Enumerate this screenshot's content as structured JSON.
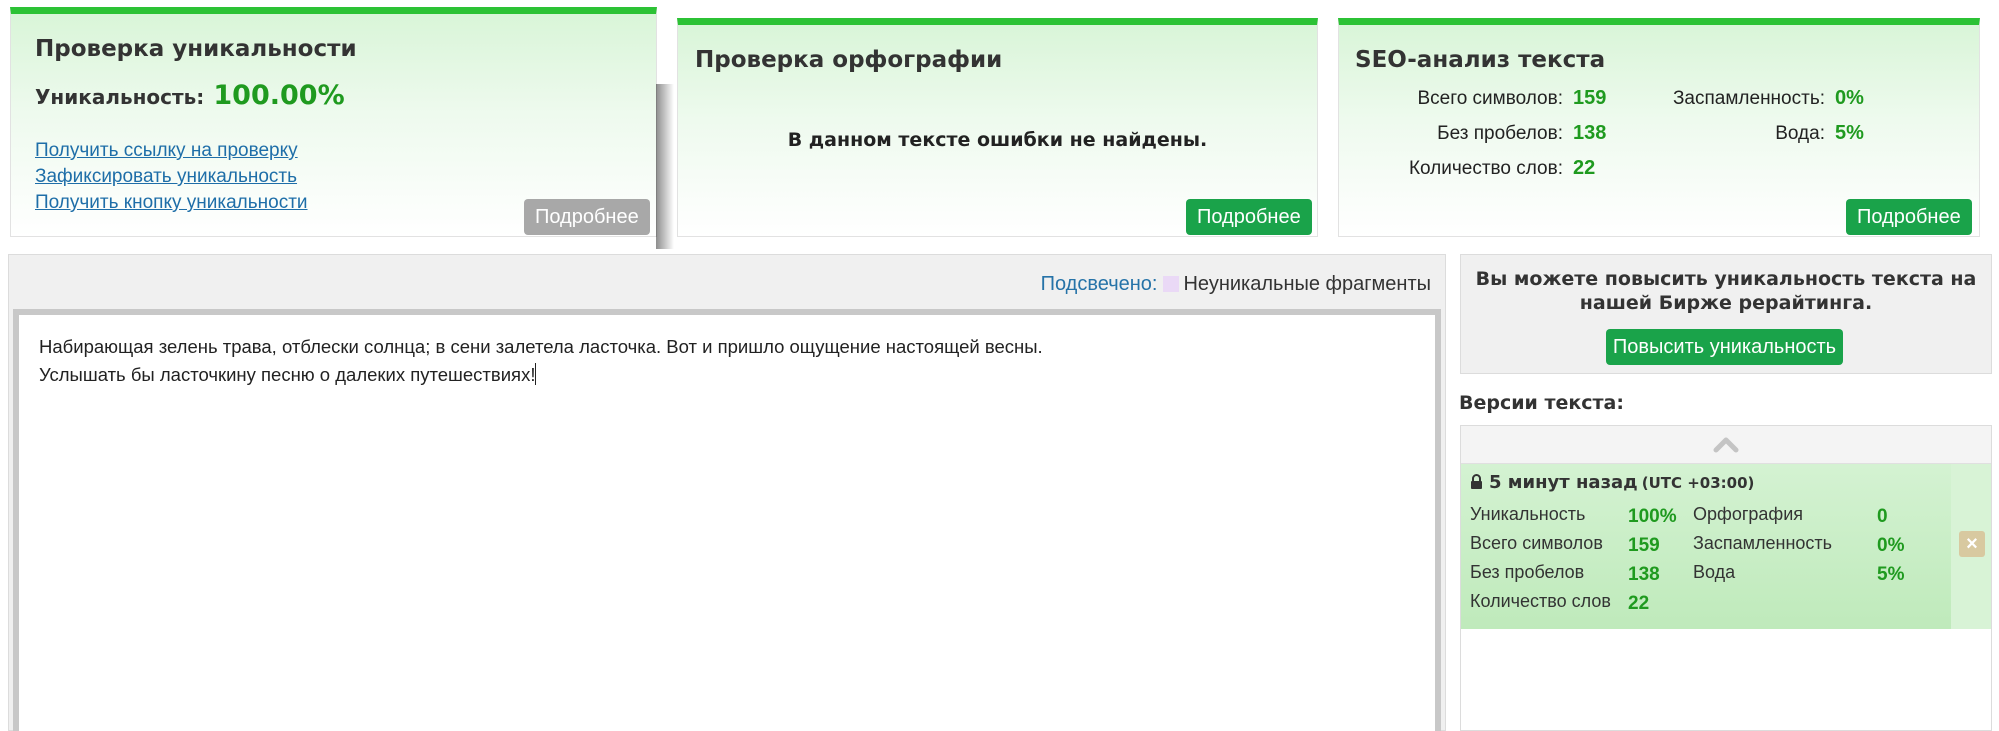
{
  "uniqueness_card": {
    "title": "Проверка уникальности",
    "uniqueness_label": "Уникальность:",
    "uniqueness_value": "100.00%",
    "links": [
      "Получить ссылку на проверку",
      "Зафиксировать уникальность",
      "Получить кнопку уникальности"
    ],
    "more_label": "Подробнее"
  },
  "spelling_card": {
    "title": "Проверка орфографии",
    "message": "В данном тексте ошибки не найдены.",
    "more_label": "Подробнее"
  },
  "seo_card": {
    "title": "SEO-анализ текста",
    "total_chars_label": "Всего символов:",
    "total_chars_value": "159",
    "no_spaces_label": "Без пробелов:",
    "no_spaces_value": "138",
    "word_count_label": "Количество слов:",
    "word_count_value": "22",
    "spam_label": "Заспамленность:",
    "spam_value": "0%",
    "water_label": "Вода:",
    "water_value": "5%",
    "more_label": "Подробнее"
  },
  "editor": {
    "highlight_label": "Подсвечено:",
    "highlight_desc": "Неуникальные фрагменты",
    "line1": "Набирающая зелень трава, отблески солнца; в сени залетела ласточка. Вот и пришло ощущение настоящей весны.",
    "line2": "Услышать бы ласточкину песню о далеких путешествиях!"
  },
  "boost": {
    "text_line1": "Вы можете повысить уникальность текста на",
    "text_line2": "нашей Бирже рерайтинга.",
    "button_label": "Повысить уникальность"
  },
  "versions": {
    "title": "Версии текста:",
    "items": [
      {
        "time": "5 минут назад",
        "timezone": "(UTC +03:00)",
        "uniqueness_label": "Уникальность",
        "uniqueness_value": "100%",
        "total_chars_label": "Всего символов",
        "total_chars_value": "159",
        "no_spaces_label": "Без пробелов",
        "no_spaces_value": "138",
        "word_count_label": "Количество слов",
        "word_count_value": "22",
        "spelling_label": "Орфография",
        "spelling_value": "0",
        "spam_label": "Заспамленность",
        "spam_value": "0%",
        "water_label": "Вода",
        "water_value": "5%"
      }
    ]
  },
  "colors": {
    "accent_green": "#2cc235",
    "button_green": "#1aa34a",
    "value_green": "#1f9a1f",
    "link_blue": "#1e6ea8",
    "highlight_swatch": "#ead9f6"
  },
  "icons": [
    "lock-icon",
    "chevron-up-icon",
    "close-icon"
  ]
}
